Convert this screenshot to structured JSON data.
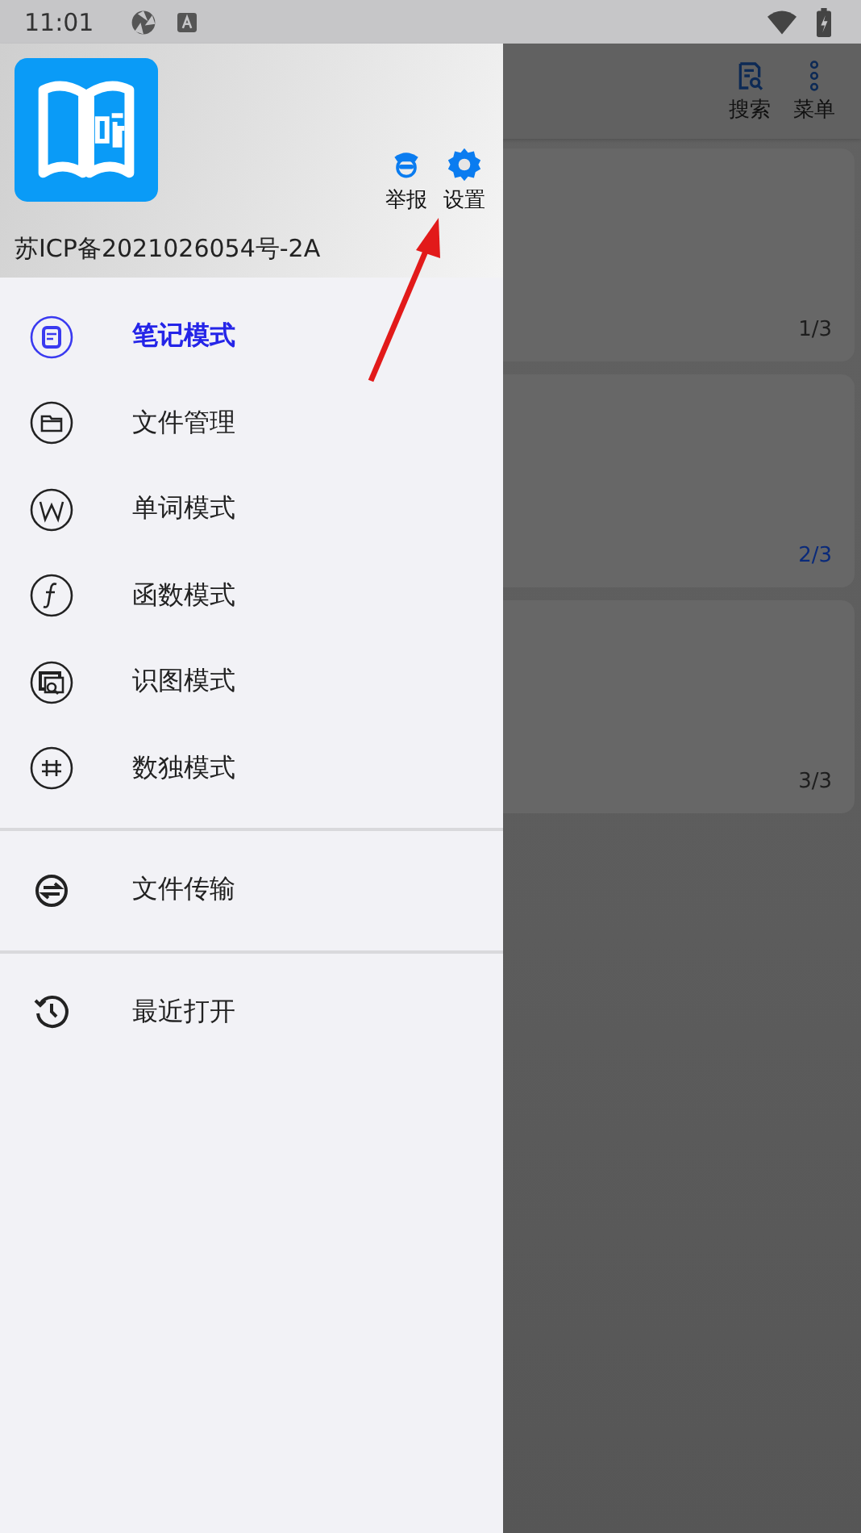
{
  "status_bar": {
    "time": "11:01"
  },
  "app_bar": {
    "actions": [
      {
        "label": "搜索"
      },
      {
        "label": "菜单"
      }
    ]
  },
  "cards": [
    {
      "page": "1/3",
      "selected": false
    },
    {
      "page": "2/3",
      "selected": true
    },
    {
      "page": "3/3",
      "selected": false
    }
  ],
  "drawer": {
    "header": {
      "actions": [
        {
          "label": "举报"
        },
        {
          "label": "设置"
        }
      ],
      "license": "苏ICP备2021026054号-2A"
    },
    "sections": [
      [
        {
          "label": "笔记模式",
          "selected": true
        },
        {
          "label": "文件管理",
          "selected": false
        },
        {
          "label": "单词模式",
          "selected": false
        },
        {
          "label": "函数模式",
          "selected": false
        },
        {
          "label": "识图模式",
          "selected": false
        },
        {
          "label": "数独模式",
          "selected": false
        }
      ],
      [
        {
          "label": "文件传输",
          "selected": false
        }
      ],
      [
        {
          "label": "最近打开",
          "selected": false
        }
      ]
    ]
  }
}
